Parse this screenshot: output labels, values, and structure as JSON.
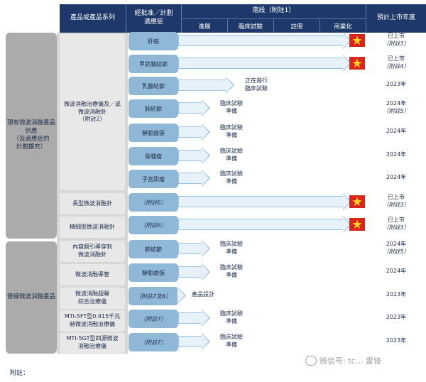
{
  "header": {
    "series": "產品或產品系列",
    "indication": "經批准／計劃\n適應症",
    "stage": "階段（附註1）",
    "stages": [
      "進展",
      "臨床試驗",
      "註冊",
      "商業化"
    ],
    "launch": "預計上市年度"
  },
  "groups": [
    {
      "label": "現有微波消融產品\n供應\n（及適應症的\n計劃擴充）"
    },
    {
      "label": "管線微波消融產品"
    }
  ],
  "series": [
    {
      "label": "微波消融治療儀及／或\n微波消融針\n（附註2）"
    },
    {
      "label": "長型微波消融針"
    },
    {
      "label": "精細型微波消融針"
    },
    {
      "label": "內窺鏡引導穿刺\n微波消融針"
    },
    {
      "label": "微波消融導管"
    },
    {
      "label": "微波消融超聲\n綜合治療儀"
    },
    {
      "label": "MTI-5FT型0.915千兆\n赫微波消融治療儀"
    },
    {
      "label": "MTI-5GT型四源微波\n消融治療儀"
    }
  ],
  "rows": [
    {
      "indication": "肝癌",
      "status": "",
      "launch": "已上市",
      "note": "（附註3）",
      "flag": true
    },
    {
      "indication": "甲狀腺結節",
      "status": "",
      "launch": "已上市",
      "note": "（附註4）",
      "flag": true
    },
    {
      "indication": "乳腺結節",
      "status": "正在進行\n臨床試驗",
      "launch": "2023年",
      "note": ""
    },
    {
      "indication": "肺結節",
      "status": "臨床試驗\n準備",
      "launch": "2024年",
      "note": "（附註5）"
    },
    {
      "indication": "靜脈曲張",
      "status": "臨床試驗\n準備",
      "launch": "2024年",
      "note": ""
    },
    {
      "indication": "骨腫瘤",
      "status": "臨床試驗\n準備",
      "launch": "2024年",
      "note": ""
    },
    {
      "indication": "子宮肌瘤",
      "status": "臨床試驗\n準備",
      "launch": "2024年",
      "note": ""
    },
    {
      "indication": "（附註6）",
      "status": "",
      "launch": "已上市",
      "note": "（附註3）",
      "flag": true
    },
    {
      "indication": "（附註6）",
      "status": "",
      "launch": "已上市",
      "note": "（附註3）",
      "flag": true
    },
    {
      "indication": "肺結節",
      "status": "臨床試驗\n準備",
      "launch": "2024年",
      "note": "（附註5）"
    },
    {
      "indication": "靜脈曲張",
      "status": "臨床試驗\n準備",
      "launch": "2024年",
      "note": ""
    },
    {
      "indication": "（附註7及8）",
      "status": "產品設計",
      "launch": "2023年",
      "note": ""
    },
    {
      "indication": "（附註7）",
      "status": "臨床試驗\n準備",
      "launch": "2023年",
      "note": ""
    },
    {
      "indication": "（附註7）",
      "status": "臨床試驗\n準備",
      "launch": "2023年",
      "note": ""
    }
  ],
  "footer": {
    "notes_label": "附註：",
    "watermark": "微信号: tc… 雷锋"
  },
  "colors": {
    "header": "#1e3869",
    "pill": "#8fb7d8",
    "arrow": "#e7f1fa",
    "flag": "#d9261c",
    "star": "#ffd21f"
  }
}
